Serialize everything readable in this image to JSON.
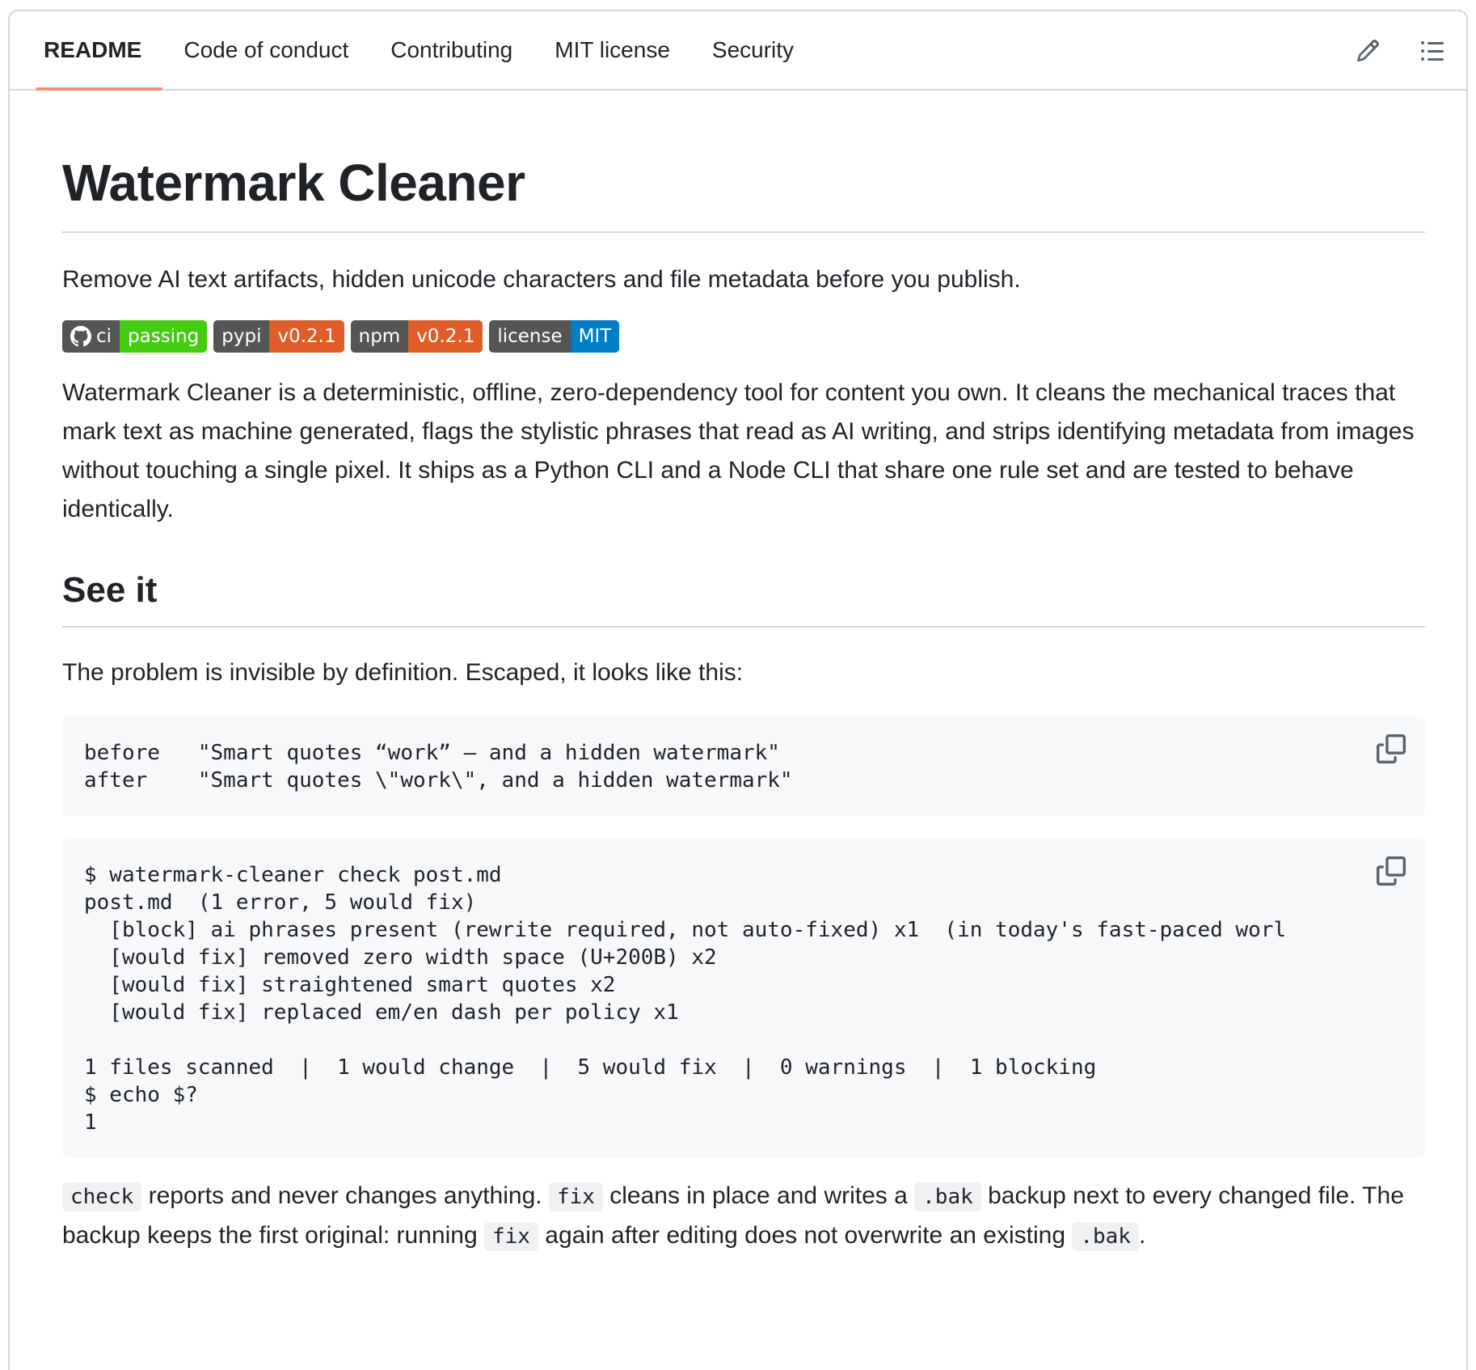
{
  "tabs": [
    {
      "label": "README",
      "active": true
    },
    {
      "label": "Code of conduct"
    },
    {
      "label": "Contributing"
    },
    {
      "label": "MIT license"
    },
    {
      "label": "Security"
    }
  ],
  "icons": {
    "edit": "pencil-icon",
    "outline": "list-icon",
    "copy": "copy-icon"
  },
  "readme": {
    "title": "Watermark Cleaner",
    "tagline": "Remove AI text artifacts, hidden unicode characters and file metadata before you publish.",
    "badges": [
      {
        "label": "ci",
        "value": "passing",
        "color": "#4c1",
        "has_logo": true
      },
      {
        "label": "pypi",
        "value": "v0.2.1",
        "color": "#e05d2a"
      },
      {
        "label": "npm",
        "value": "v0.2.1",
        "color": "#e05d2a"
      },
      {
        "label": "license",
        "value": "MIT",
        "color": "#007ec6"
      }
    ],
    "intro": "Watermark Cleaner is a deterministic, offline, zero-dependency tool for content you own. It cleans the mechanical traces that mark text as machine generated, flags the stylistic phrases that read as AI writing, and strips identifying metadata from images without touching a single pixel. It ships as a Python CLI and a Node CLI that share one rule set and are tested to behave identically.",
    "see_it_heading": "See it",
    "problem_text": "The problem is invisible by definition. Escaped, it looks like this:",
    "code_block_1": "before   \"Smart quotes “work” — and a hidden watermark\"\nafter    \"Smart quotes \\\"work\\\", and a hidden watermark\"",
    "code_block_2": "$ watermark-cleaner check post.md\npost.md  (1 error, 5 would fix)\n  [block] ai phrases present (rewrite required, not auto-fixed) x1  (in today's fast-paced worl\n  [would fix] removed zero width space (U+200B) x2\n  [would fix] straightened smart quotes x2\n  [would fix] replaced em/en dash per policy x1\n\n1 files scanned  |  1 would change  |  5 would fix  |  0 warnings  |  1 blocking\n$ echo $?\n1",
    "after_text": {
      "code_check": "check",
      "t1": " reports and never changes anything. ",
      "code_fix": "fix",
      "t2": " cleans in place and writes a ",
      "code_bak": ".bak",
      "t3": " backup next to every changed file. The backup keeps the first original: running ",
      "code_fix2": "fix",
      "t4": " again after editing does not overwrite an existing ",
      "code_bak2": ".bak",
      "t5": "."
    }
  }
}
